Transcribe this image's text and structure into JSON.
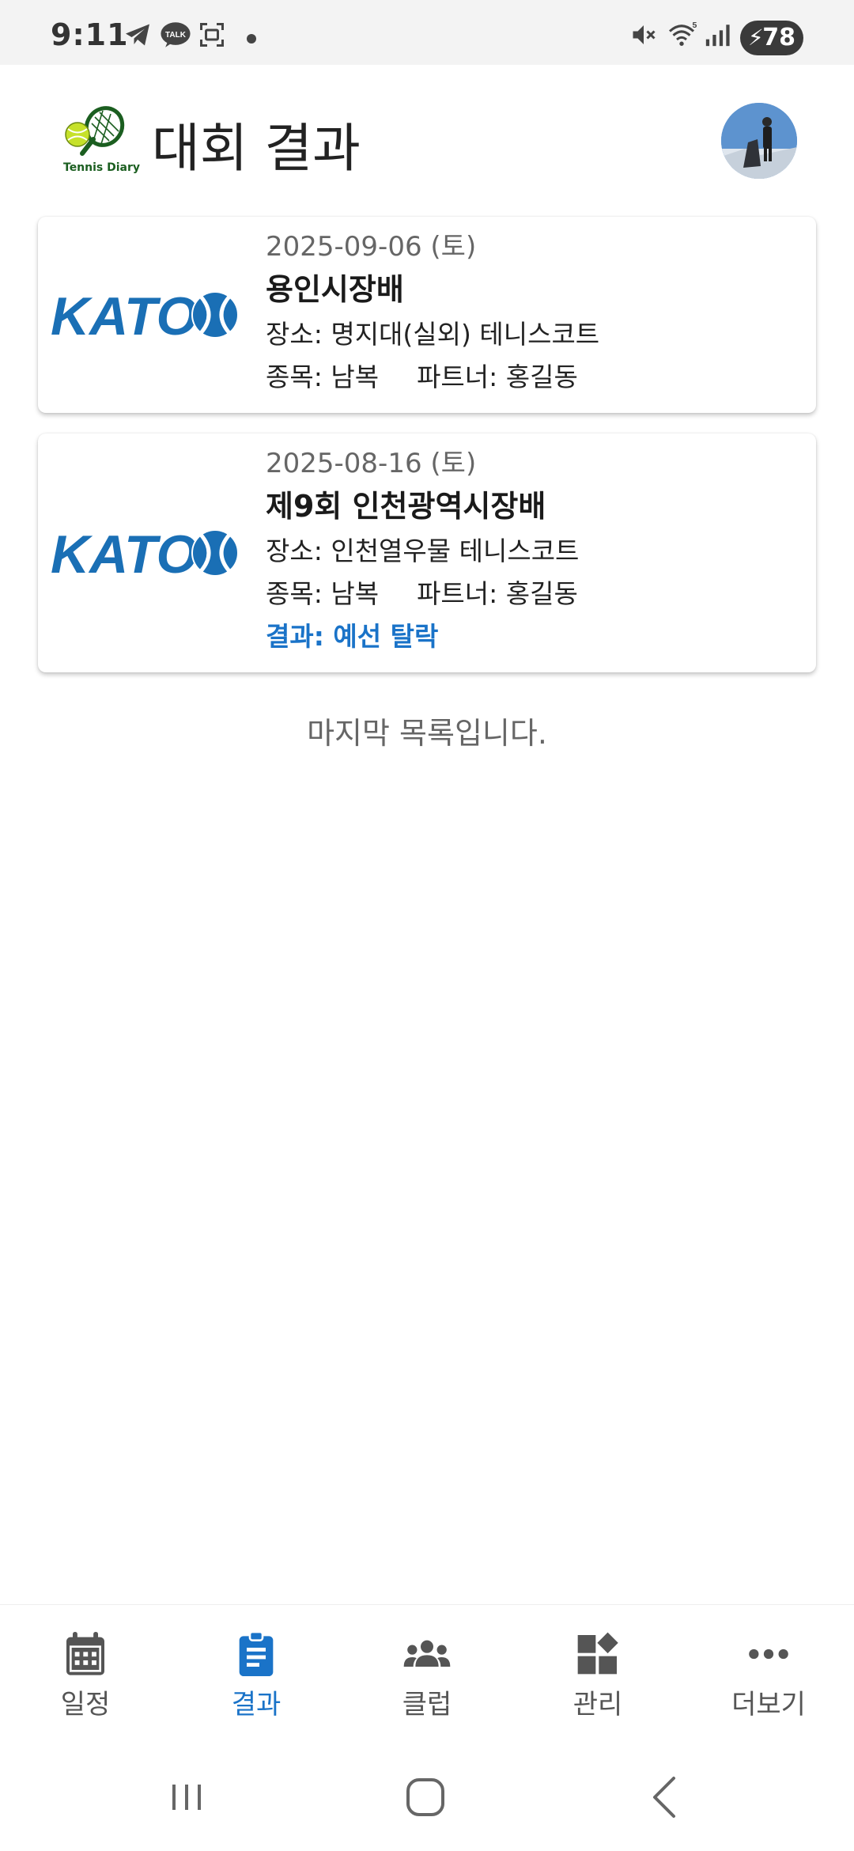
{
  "status_bar": {
    "time": "9:11",
    "battery": "78",
    "icons": [
      "telegram-icon",
      "kakaotalk-icon",
      "screenshot-icon",
      "notification-dot",
      "mute-icon",
      "wifi-icon",
      "signal-icon",
      "battery-charging-icon"
    ]
  },
  "header": {
    "logo_text": "Tennis Diary",
    "title": "대회 결과",
    "avatar": "user-avatar"
  },
  "tournaments": [
    {
      "logo": "KATO",
      "date": "2025-09-06 (토)",
      "name": "용인시장배",
      "venue": "장소: 명지대(실외) 테니스코트",
      "event": "종목: 남복",
      "partner": "파트너: 홍길동",
      "result": ""
    },
    {
      "logo": "KATO",
      "date": "2025-08-16 (토)",
      "name": "제9회 인천광역시장배",
      "venue": "장소: 인천열우물 테니스코트",
      "event": "종목: 남복",
      "partner": "파트너: 홍길동",
      "result": "결과: 예선 탈락"
    }
  ],
  "list_end_text": "마지막 목록입니다.",
  "bottom_nav": {
    "active": "결과",
    "items": [
      {
        "label": "일정",
        "icon": "calendar-icon"
      },
      {
        "label": "결과",
        "icon": "clipboard-icon"
      },
      {
        "label": "클럽",
        "icon": "group-icon"
      },
      {
        "label": "관리",
        "icon": "widgets-icon"
      },
      {
        "label": "더보기",
        "icon": "more-icon"
      }
    ]
  },
  "colors": {
    "accent": "#1a73c8",
    "kato_blue": "#1a6fb5",
    "inactive_icon": "#555555"
  }
}
